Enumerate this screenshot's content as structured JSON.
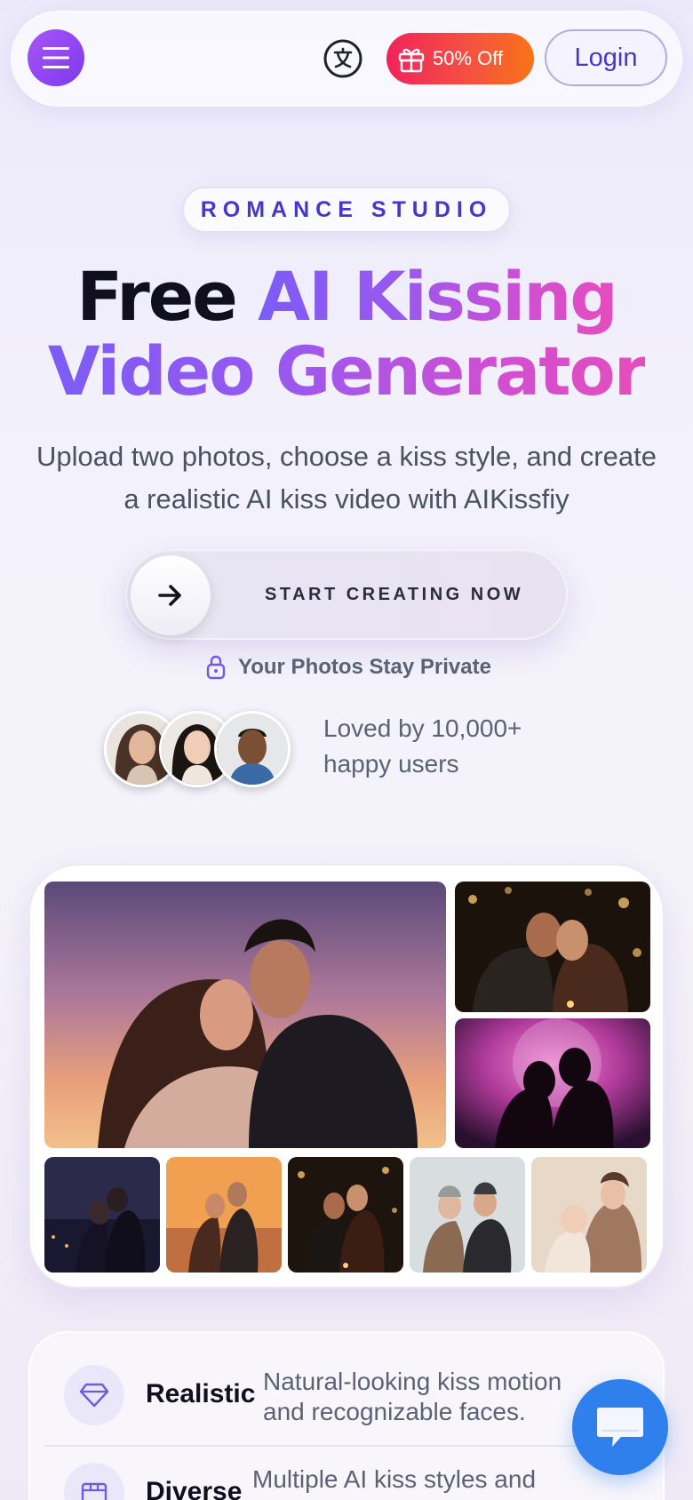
{
  "header": {
    "menu_icon": "hamburger-icon",
    "language_icon": "translate-icon",
    "promo_label": "50% Off",
    "promo_icon": "gift-icon",
    "login_label": "Login"
  },
  "hero": {
    "badge": "ROMANCE STUDIO",
    "title_part1": "Free ",
    "title_part2": "AI Kissing",
    "title_part3": "Video Generator",
    "subtitle": "Upload two photos, choose a kiss style, and create a realistic AI kiss video with AIKissfiy",
    "cta_label": "START CREATING NOW",
    "privacy_text": "Your Photos Stay Private",
    "social_proof": "Loved by 10,000+ happy users"
  },
  "features": [
    {
      "title": "Realistic",
      "desc": "Natural-looking kiss motion and recognizable faces.",
      "icon": "diamond-icon"
    },
    {
      "title": "Diverse",
      "desc": "Multiple AI kiss styles and scenes.",
      "icon": "box-icon"
    }
  ],
  "chat": {
    "icon": "chat-icon"
  },
  "colors": {
    "accent": "#7c5cf6",
    "pink": "#e64dbb",
    "promo": "#f0245a",
    "chat": "#2f80ed"
  }
}
